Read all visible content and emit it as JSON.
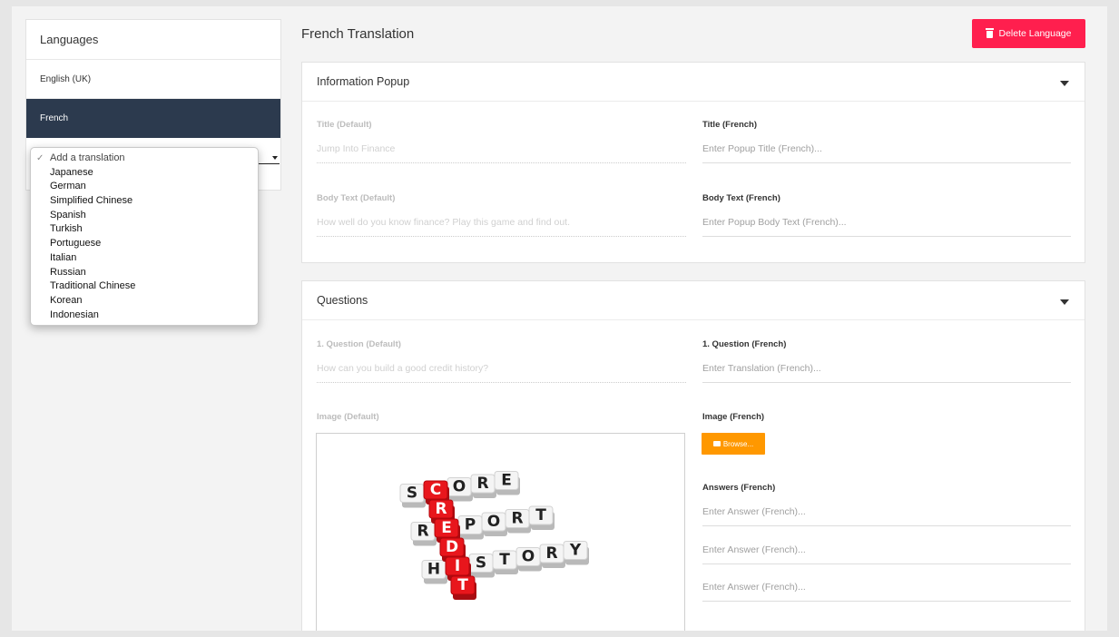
{
  "sidebar": {
    "title": "Languages",
    "items": [
      {
        "label": "English (UK)",
        "active": false
      },
      {
        "label": "French",
        "active": true
      }
    ]
  },
  "dropdown": {
    "selected": "Add a translation",
    "options": [
      "Add a translation",
      "Japanese",
      "German",
      "Simplified Chinese",
      "Spanish",
      "Turkish",
      "Portuguese",
      "Italian",
      "Russian",
      "Traditional Chinese",
      "Korean",
      "Indonesian"
    ]
  },
  "header": {
    "title": "French Translation",
    "delete_label": "Delete Language"
  },
  "popup": {
    "title": "Information Popup",
    "title_default_label": "Title (Default)",
    "title_default_value": "Jump Into Finance",
    "title_french_label": "Title (French)",
    "title_french_placeholder": "Enter Popup Title (French)...",
    "body_default_label": "Body Text (Default)",
    "body_default_value": "How well do you know finance? Play this game and find out.",
    "body_french_label": "Body Text (French)",
    "body_french_placeholder": "Enter Popup Body Text (French)..."
  },
  "questions": {
    "title": "Questions",
    "q1_default_label": "1. Question (Default)",
    "q1_default_value": "How can you build a good credit history?",
    "q1_french_label": "1. Question (French)",
    "q1_french_placeholder": "Enter Translation (French)...",
    "image_default_label": "Image (Default)",
    "image_french_label": "Image (French)",
    "browse_label": "Browse...",
    "answers_label": "Answers (French)",
    "answer_placeholders": [
      "Enter Answer (French)...",
      "Enter Answer (French)...",
      "Enter Answer (French)..."
    ]
  },
  "image": {
    "down_word": "CREDIT",
    "across_words": [
      "SCORE",
      "REPORT",
      "HISTORY"
    ]
  },
  "colors": {
    "sidebar_active": "#2c3a4e",
    "danger": "#ff1f4e",
    "browse": "#ff9800",
    "tile_red": "#e8161c"
  }
}
